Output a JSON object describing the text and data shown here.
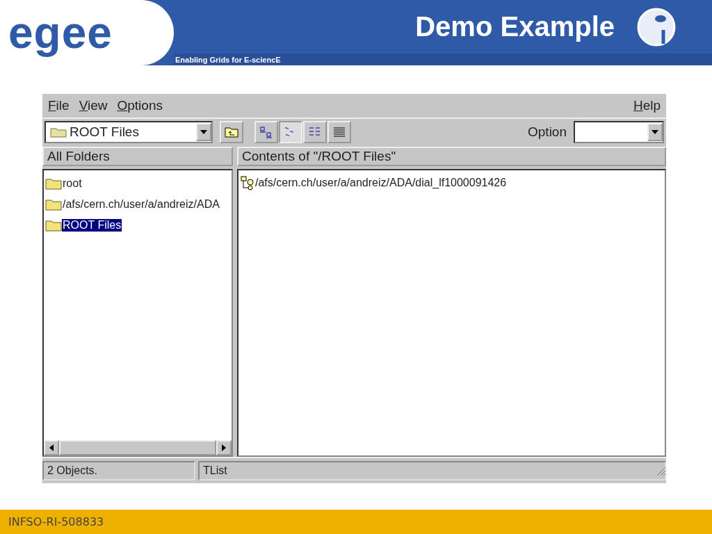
{
  "slide": {
    "logo": "egee",
    "tagline": "Enabling Grids for E-sciencE",
    "title": "Demo Example",
    "footer": "INFSO-RI-508833"
  },
  "window": {
    "menu": [
      {
        "label": "File"
      },
      {
        "label": "View"
      },
      {
        "label": "Options"
      }
    ],
    "help_menu": {
      "label": "Help"
    },
    "toolbar": {
      "location": "ROOT Files",
      "view_buttons": [
        {
          "kind": "large-icons",
          "selected": false
        },
        {
          "kind": "small-icons",
          "selected": true
        },
        {
          "kind": "list",
          "selected": false
        },
        {
          "kind": "details",
          "selected": false
        }
      ],
      "option_label": "Option"
    },
    "folders": {
      "header": "All Folders",
      "items": [
        {
          "label": "root",
          "selected": false
        },
        {
          "label": "/afs/cern.ch/user/a/andreiz/ADA",
          "selected": false
        },
        {
          "label": "ROOT Files",
          "selected": true
        }
      ]
    },
    "contents": {
      "header": "Contents of \"/ROOT Files\"",
      "items": [
        {
          "label": "/afs/cern.ch/user/a/andreiz/ADA/dial_lf1000091426"
        }
      ]
    },
    "status_bar": [
      "2 Objects.",
      "TList"
    ]
  }
}
